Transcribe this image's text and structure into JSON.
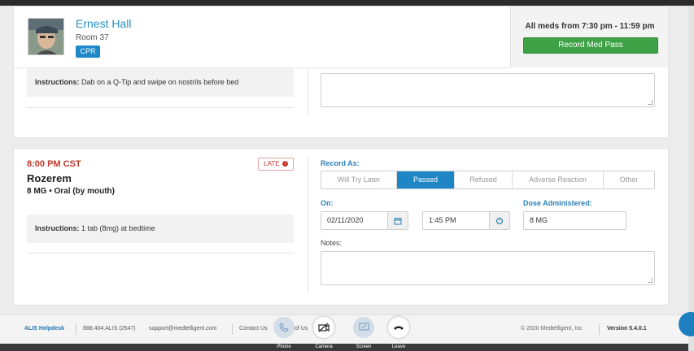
{
  "resident": {
    "name": "Ernest Hall",
    "room": "Room 37",
    "badge": "CPR"
  },
  "med_pass": {
    "window_label": "All meds from 7:30 pm - 11:59 pm",
    "record_button": "Record Med Pass"
  },
  "med1": {
    "instructions_label": "Instructions:",
    "instructions_text": "Dab on a Q-Tip and swipe on nostrils before bed"
  },
  "med2": {
    "time": "8:00 PM CST",
    "late_badge": "LATE",
    "drug": "Rozerem",
    "dose": "8 MG",
    "route": "Oral (by mouth)",
    "instructions_label": "Instructions:",
    "instructions_text": "1 tab (8mg) at bedtime",
    "record_as_label": "Record As:",
    "record_options": [
      "Will Try Later",
      "Passed",
      "Refused",
      "Adverse Reaction",
      "Other"
    ],
    "selected_option": "Passed",
    "on_label": "On:",
    "date_value": "02/11/2020",
    "time_value": "1:45 PM",
    "dose_label": "Dose Administered:",
    "dose_value": "8 MG",
    "notes_label": "Notes:"
  },
  "footer": {
    "helpdesk": "ALIS Helpdesk",
    "phone": "888.404.ALIS (2547)",
    "email": "support@medtelligent.com",
    "contact": "Contact Us",
    "terms_fragment": "of Us",
    "copyright": "© 2020 Medtelligent, Inc",
    "version": "Version 5.4.0.1"
  },
  "call_controls": {
    "phone": "Phone",
    "camera": "Camera",
    "screen": "Screen",
    "leave": "Leave"
  },
  "colors": {
    "accent_blue": "#1f86c6",
    "late_red": "#c0392b",
    "record_green": "#3fa146"
  }
}
